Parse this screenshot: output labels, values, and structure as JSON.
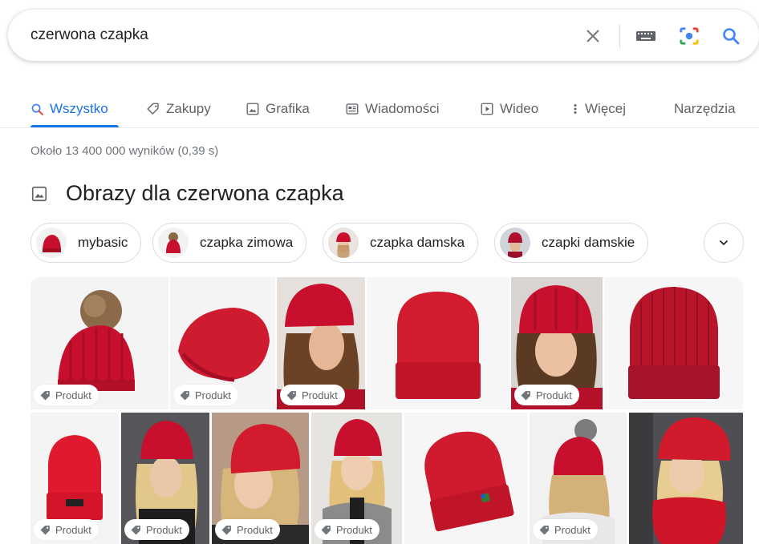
{
  "search": {
    "query": "czerwona czapka"
  },
  "tabs": [
    {
      "label": "Wszystko",
      "icon": "search-icon",
      "active": true
    },
    {
      "label": "Zakupy",
      "icon": "tag-icon"
    },
    {
      "label": "Grafika",
      "icon": "image-icon"
    },
    {
      "label": "Wiadomości",
      "icon": "news-icon"
    },
    {
      "label": "Wideo",
      "icon": "video-icon"
    },
    {
      "label": "Więcej",
      "icon": "more-vert-icon"
    }
  ],
  "tools_label": "Narzędzia",
  "result_stats": "Około 13 400 000 wyników (0,39 s)",
  "images_heading": "Obrazy dla czerwona czapka",
  "chips": [
    {
      "label": "mybasic"
    },
    {
      "label": "czapka zimowa"
    },
    {
      "label": "czapka damska"
    },
    {
      "label": "czapki damskie"
    }
  ],
  "tiles": [
    {
      "badge": "Produkt"
    },
    {
      "badge": "Produkt"
    },
    {
      "badge": "Produkt"
    },
    {
      "badge": ""
    },
    {
      "badge": "Produkt"
    },
    {
      "badge": ""
    },
    {
      "badge": "Produkt"
    },
    {
      "badge": "Produkt"
    },
    {
      "badge": "Produkt"
    },
    {
      "badge": "Produkt"
    },
    {
      "badge": ""
    },
    {
      "badge": "Produkt"
    },
    {
      "badge": ""
    }
  ],
  "colors": {
    "accent": "#1a73e8",
    "hat_red": "#d0152a",
    "muted_text": "#70757a"
  }
}
